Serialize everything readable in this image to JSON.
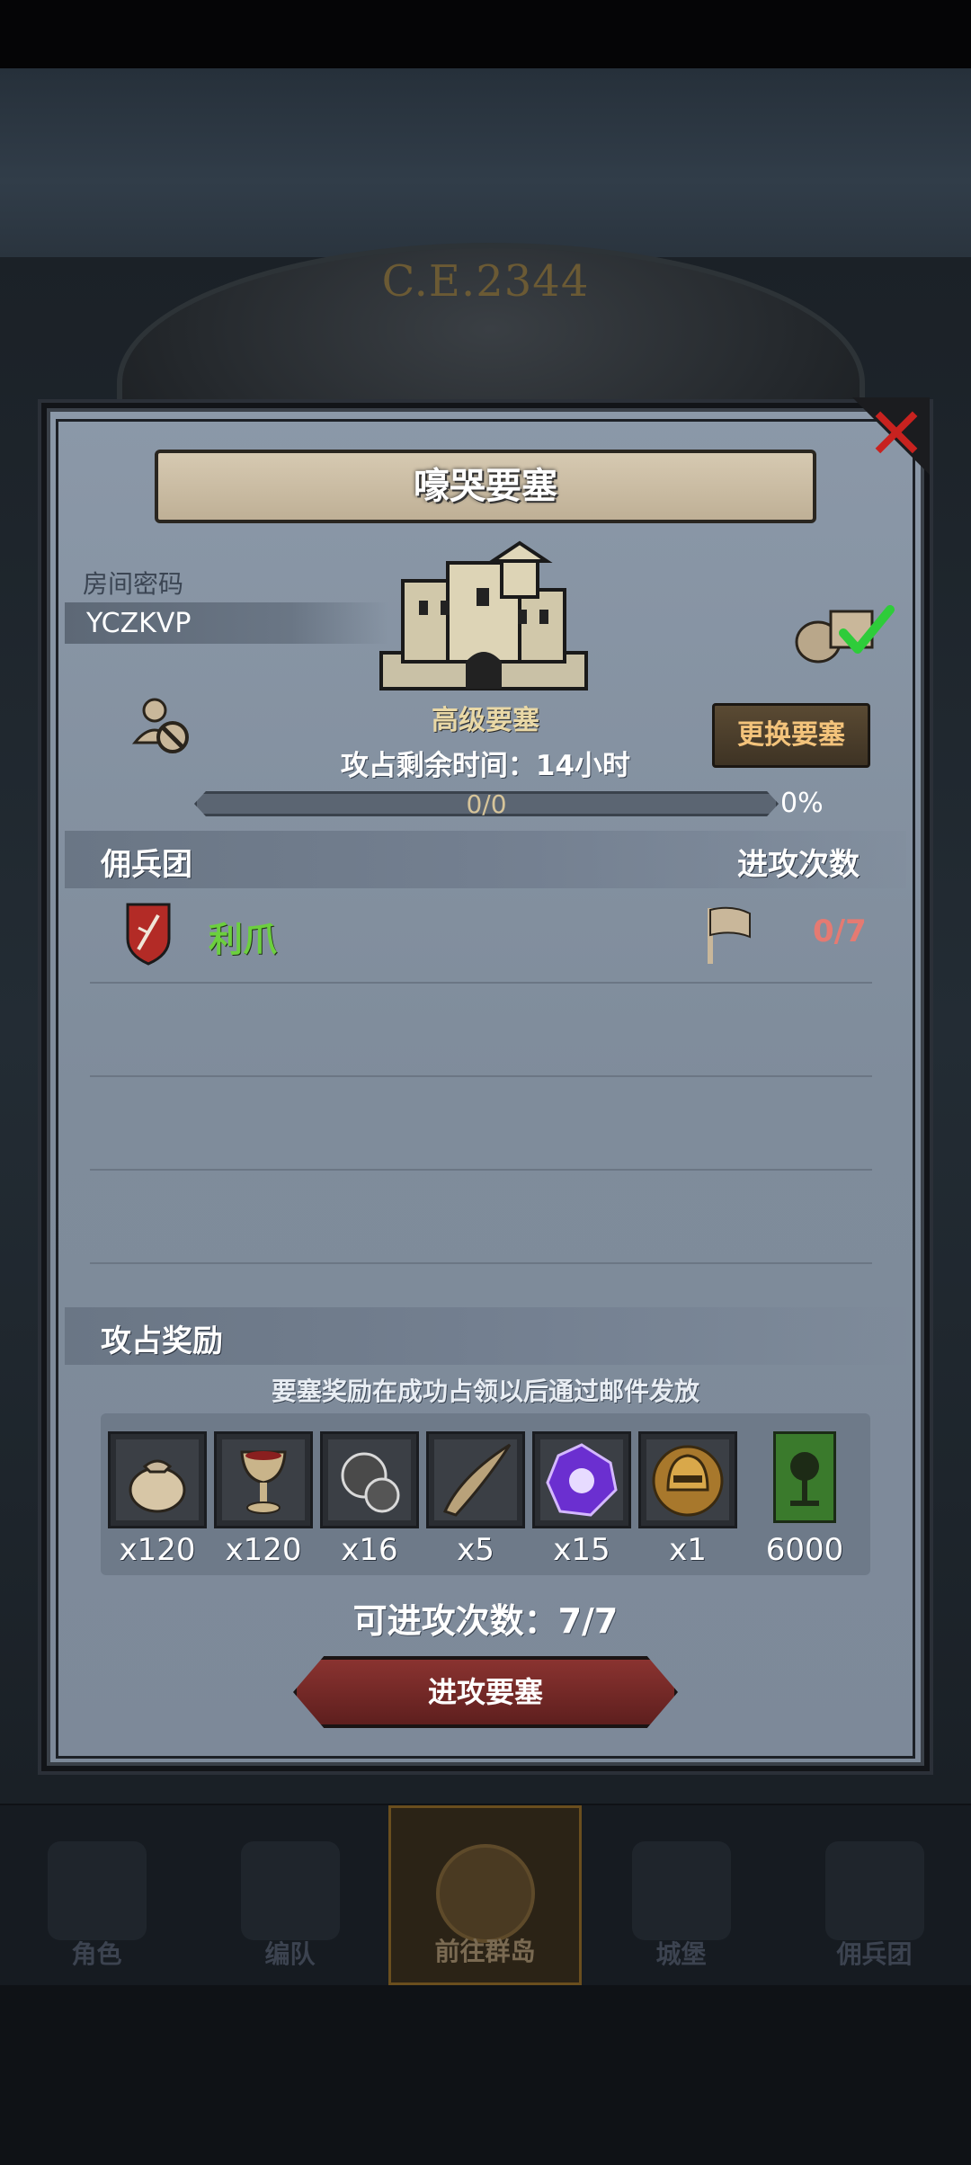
{
  "background": {
    "year": "C.E.2344"
  },
  "nav": {
    "items": [
      {
        "label": "角色",
        "active": false
      },
      {
        "label": "编队",
        "active": false
      },
      {
        "label": "前往群岛",
        "active": true
      },
      {
        "label": "城堡",
        "active": false
      },
      {
        "label": "佣兵团",
        "active": false
      }
    ]
  },
  "modal": {
    "title": "嚎哭要塞",
    "room_label": "房间密码",
    "room_code": "YCZKVP",
    "fortress_name": "高级要塞",
    "change_button": "更换要塞",
    "time_remaining": "攻占剩余时间：14小时",
    "progress": {
      "text": "0/0",
      "percent_label": "0%",
      "fraction": 0
    },
    "table": {
      "left_header": "佣兵团",
      "right_header": "进攻次数",
      "rows": [
        {
          "name": "利爪",
          "count": "0/7"
        }
      ]
    },
    "rewards": {
      "title": "攻占奖励",
      "note": "要塞奖励在成功占领以后通过邮件发放",
      "items": [
        {
          "icon": "coin-bag-icon",
          "count": "x120"
        },
        {
          "icon": "goblet-icon",
          "count": "x120"
        },
        {
          "icon": "ore-icon",
          "count": "x16"
        },
        {
          "icon": "horn-icon",
          "count": "x5"
        },
        {
          "icon": "purple-gem-icon",
          "count": "x15"
        },
        {
          "icon": "golden-helmet-icon",
          "count": "x1"
        },
        {
          "icon": "tree-banner-icon",
          "count": "6000"
        }
      ]
    },
    "attack_times": "可进攻次数：7/7",
    "attack_button": "进攻要塞"
  },
  "colors": {
    "panel": "#7f8c9b",
    "accent_gold": "#f3c37b",
    "mercenary_green": "#6ccf3e",
    "count_red": "#e57a72",
    "close_red": "#c8221f"
  }
}
